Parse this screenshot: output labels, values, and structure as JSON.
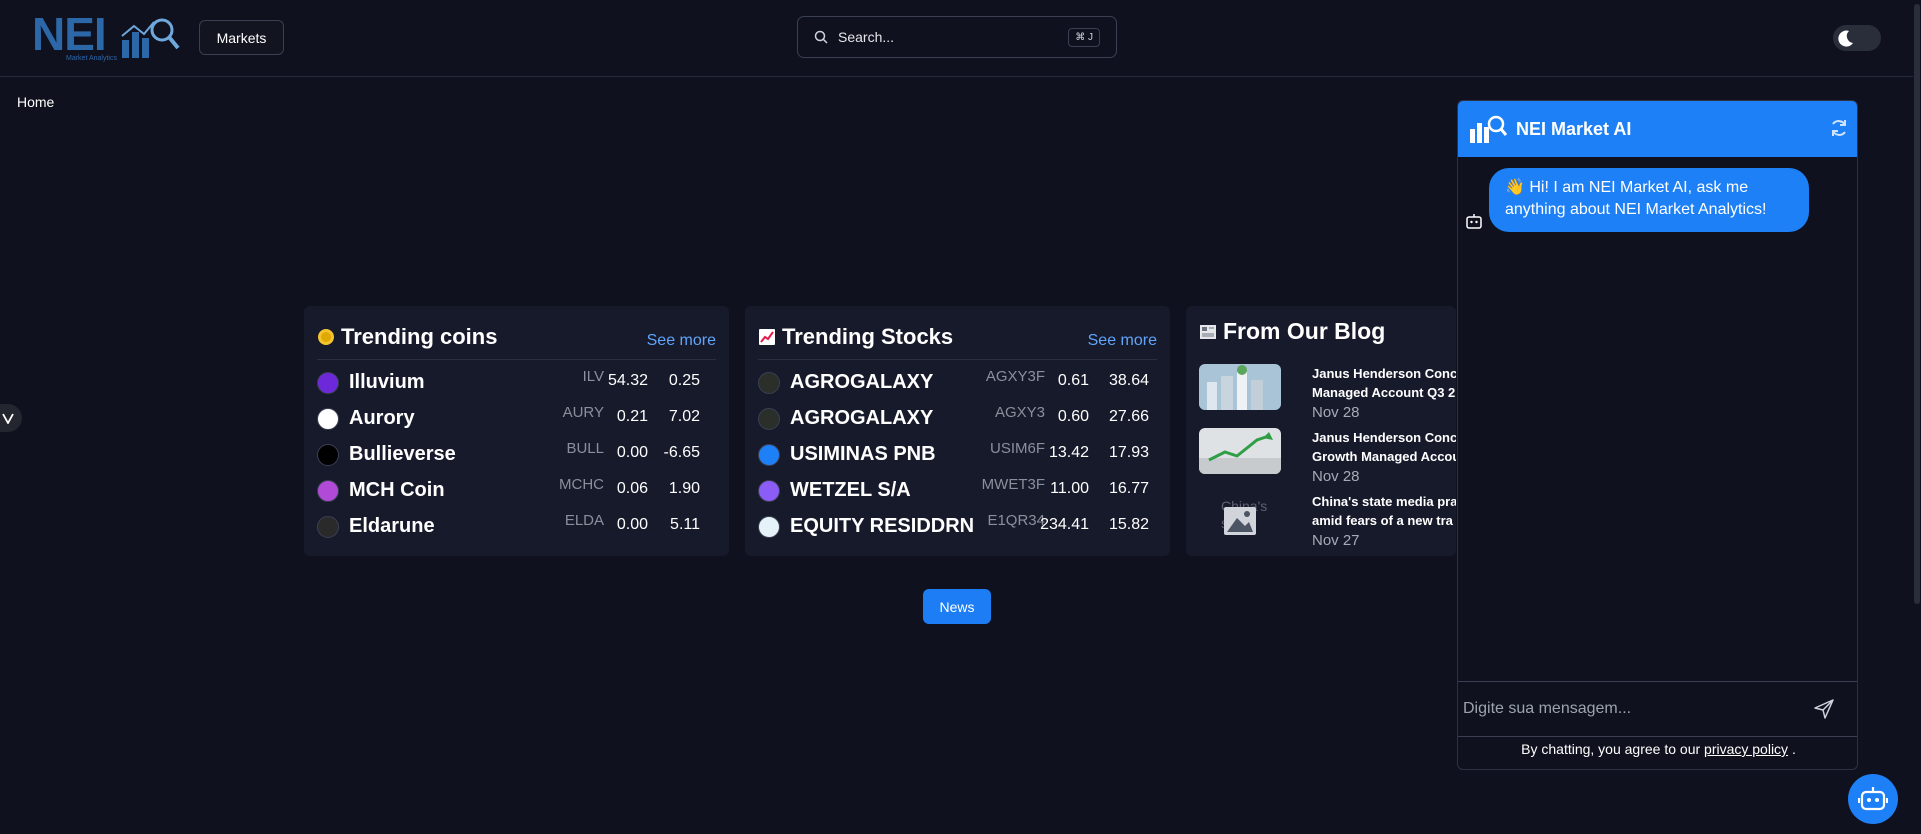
{
  "header": {
    "logo_text": "NEI",
    "logo_sub": "Market Analytics",
    "markets_label": "Markets",
    "search_placeholder": "Search...",
    "search_shortcut": "⌘ J"
  },
  "breadcrumb": "Home",
  "trending_coins": {
    "title": "Trending coins",
    "see_more": "See more",
    "rows": [
      {
        "name": "Illuvium",
        "symbol": "ILV",
        "price": "54.32",
        "change": "0.25",
        "icon_color": "#6d28d9"
      },
      {
        "name": "Aurory",
        "symbol": "AURY",
        "price": "0.21",
        "change": "7.02",
        "icon_color": "#ffffff"
      },
      {
        "name": "Bullieverse",
        "symbol": "BULL",
        "price": "0.00",
        "change": "-6.65",
        "icon_color": "#000000"
      },
      {
        "name": "MCH Coin",
        "symbol": "MCHC",
        "price": "0.06",
        "change": "1.90",
        "icon_color": "#b14ad6"
      },
      {
        "name": "Eldarune",
        "symbol": "ELDA",
        "price": "0.00",
        "change": "5.11",
        "icon_color": "#2a2a2a"
      }
    ]
  },
  "trending_stocks": {
    "title": "Trending Stocks",
    "see_more": "See more",
    "rows": [
      {
        "name": "AGROGALAXY",
        "symbol": "AGXY3F",
        "price": "0.61",
        "change": "38.64",
        "icon_color": "#2a2f2a"
      },
      {
        "name": "AGROGALAXY",
        "symbol": "AGXY3",
        "price": "0.60",
        "change": "27.66",
        "icon_color": "#2a2f2a"
      },
      {
        "name": "USIMINAS PNB",
        "symbol": "USIM6F",
        "price": "13.42",
        "change": "17.93",
        "icon_color": "#1e80f6"
      },
      {
        "name": "WETZEL S/A",
        "symbol": "MWET3F",
        "price": "11.00",
        "change": "16.77",
        "icon_color": "#8b5cf6"
      },
      {
        "name": "EQUITY RESIDDRN",
        "symbol": "E1QR34",
        "price": "234.41",
        "change": "15.82",
        "icon_color": "#e5f3f9"
      }
    ]
  },
  "blog": {
    "title": "From Our Blog",
    "items": [
      {
        "text": "Janus Henderson Conc Managed Account Q3 2",
        "date": "Nov 28"
      },
      {
        "text": "Janus Henderson Conc Growth Managed Accou",
        "date": "Nov 28"
      },
      {
        "text": "China's state media pra amid fears of a new tra",
        "date": "Nov 27",
        "img_alt": "China's state"
      }
    ]
  },
  "news_label": "News",
  "chat": {
    "title": "NEI Market AI",
    "greeting": "👋 Hi! I am NEI Market AI, ask me anything about NEI Market Analytics!",
    "input_placeholder": "Digite sua mensagem...",
    "footer_text": "By chatting, you agree to our",
    "footer_link": "privacy policy",
    "footer_end": "."
  },
  "colors": {
    "accent": "#1e80f6",
    "background": "#0f111e",
    "card": "#171a2b",
    "link": "#60a5fa"
  }
}
